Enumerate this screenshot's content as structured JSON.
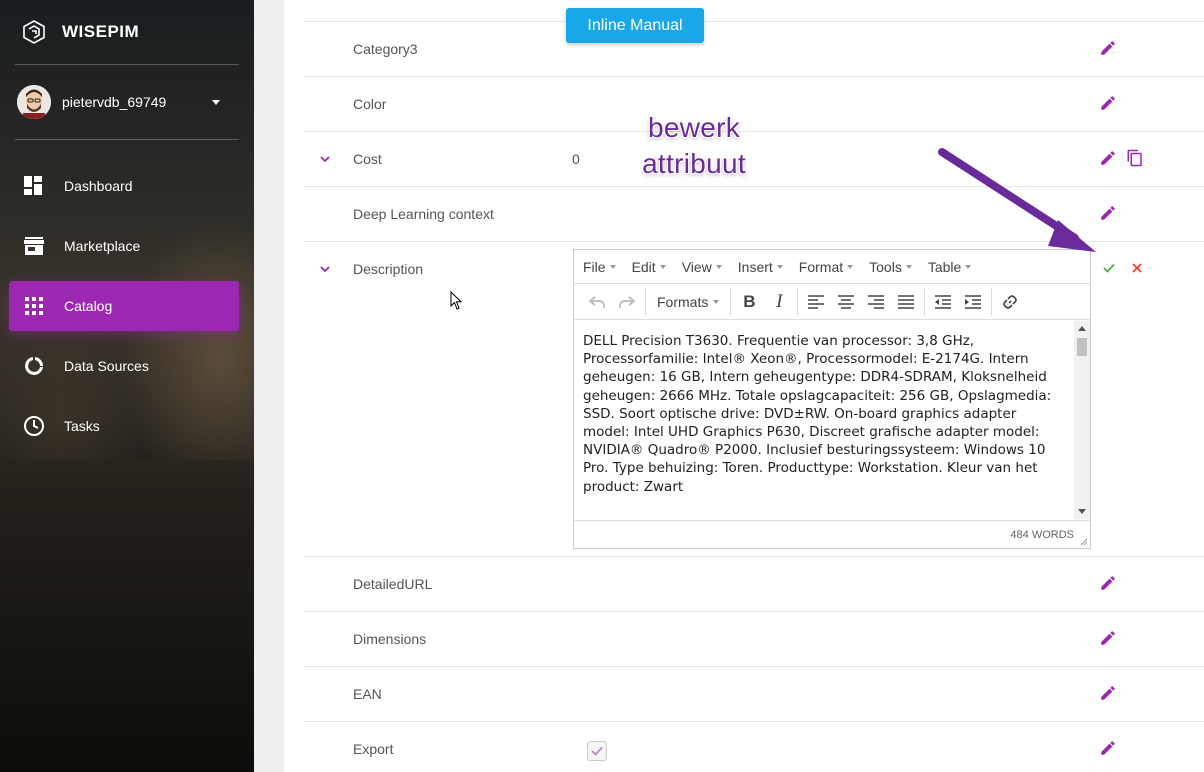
{
  "brand": {
    "name": "WISEPIM"
  },
  "user": {
    "name": "pietervdb_69749"
  },
  "nav": [
    {
      "label": "Dashboard",
      "icon": "dashboard-icon"
    },
    {
      "label": "Marketplace",
      "icon": "store-icon"
    },
    {
      "label": "Catalog",
      "icon": "grid-icon",
      "active": true
    },
    {
      "label": "Data Sources",
      "icon": "donut-icon"
    },
    {
      "label": "Tasks",
      "icon": "clock-icon"
    }
  ],
  "inline_manual": "Inline Manual",
  "annotation": {
    "line1": "bewerk",
    "line2": "attribuut"
  },
  "rows": [
    {
      "label": "Category3",
      "value": ""
    },
    {
      "label": "Color",
      "value": ""
    },
    {
      "label": "Cost",
      "value": "0"
    },
    {
      "label": "Deep Learning context",
      "value": ""
    },
    {
      "label": "Description",
      "value": ""
    },
    {
      "label": "DetailedURL",
      "value": ""
    },
    {
      "label": "Dimensions",
      "value": ""
    },
    {
      "label": "EAN",
      "value": ""
    },
    {
      "label": "Export",
      "value": ""
    }
  ],
  "editor": {
    "menus": [
      "File",
      "Edit",
      "View",
      "Insert",
      "Format",
      "Tools",
      "Table"
    ],
    "formats_label": "Formats",
    "content": "DELL Precision T3630. Frequentie van processor: 3,8 GHz, Processorfamilie: Intel® Xeon®, Processormodel: E-2174G. Intern geheugen: 16 GB, Intern geheugentype: DDR4-SDRAM, Kloksnelheid geheugen: 2666 MHz. Totale opslagcapaciteit: 256 GB, Opslagmedia: SSD. Soort optische drive: DVD±RW. On-board graphics adapter model: Intel UHD Graphics P630, Discreet grafische adapter model: NVIDIA® Quadro® P2000. Inclusief besturingssysteem: Windows 10 Pro. Type behuizing: Toren. Producttype: Workstation. Kleur van het product: Zwart",
    "word_count": "484 WORDS"
  },
  "colors": {
    "accent": "#9c27b0",
    "confirm": "#4caf50",
    "cancel": "#f44336",
    "info": "#18a7e8"
  }
}
